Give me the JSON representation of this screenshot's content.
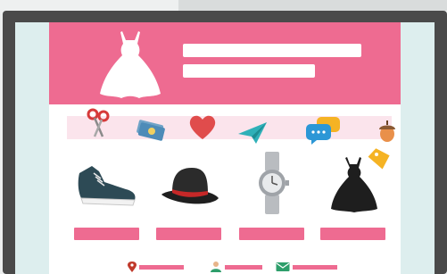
{
  "colors": {
    "accent": "#ee6b91",
    "accent_light": "#fbe4ec",
    "frame": "#4a4a4a",
    "screen_bg": "#ddeeee"
  },
  "hero": {
    "icon": "dress-icon",
    "text_lines": 2
  },
  "icon_band": {
    "icons": [
      "scissors-icon",
      "cash-icon",
      "heart-icon",
      "paper-plane-icon",
      "chat-bubbles-icon",
      "acorn-icon"
    ]
  },
  "products": [
    {
      "icon": "sneaker-icon"
    },
    {
      "icon": "hat-icon"
    },
    {
      "icon": "watch-icon"
    },
    {
      "icon": "black-dress-icon",
      "tag_icon": "price-tag-icon"
    }
  ],
  "footer": {
    "items": [
      {
        "icon": "location-pin-icon"
      },
      {
        "icon": "user-icon"
      },
      {
        "icon": "mail-icon"
      }
    ]
  }
}
